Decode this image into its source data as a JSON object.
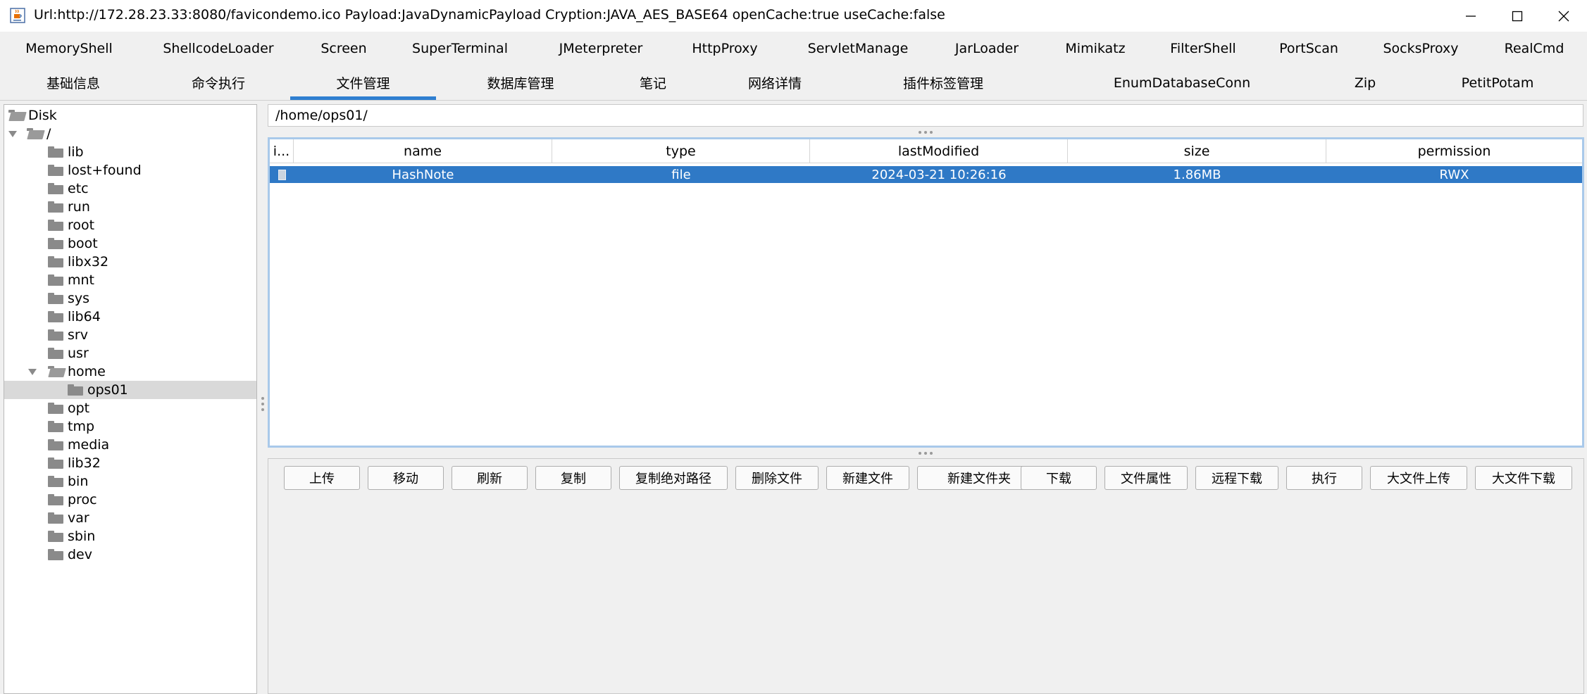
{
  "window": {
    "title": "Url:http://172.28.23.33:8080/favicondemo.ico Payload:JavaDynamicPayload Cryption:JAVA_AES_BASE64 openCache:true useCache:false"
  },
  "plugin_tabs": [
    "MemoryShell",
    "ShellcodeLoader",
    "Screen",
    "SuperTerminal",
    "JMeterpreter",
    "HttpProxy",
    "ServletManage",
    "JarLoader",
    "Mimikatz",
    "FilterShell",
    "PortScan",
    "SocksProxy",
    "RealCmd"
  ],
  "main_tabs": [
    "基础信息",
    "命令执行",
    "文件管理",
    "数据库管理",
    "笔记",
    "网络详情",
    "插件标签管理",
    "EnumDatabaseConn",
    "Zip",
    "PetitPotam"
  ],
  "active_main_tab": "文件管理",
  "tree": {
    "root_label": "Disk",
    "slash_label": "/",
    "items": [
      "lib",
      "lost+found",
      "etc",
      "run",
      "root",
      "boot",
      "libx32",
      "mnt",
      "sys",
      "lib64",
      "srv",
      "usr",
      "home",
      "ops01",
      "opt",
      "tmp",
      "media",
      "lib32",
      "bin",
      "proc",
      "var",
      "sbin",
      "dev"
    ],
    "selected": "ops01"
  },
  "path": "/home/ops01/",
  "table": {
    "headers": [
      "i...",
      "name",
      "type",
      "lastModified",
      "size",
      "permission"
    ],
    "rows": [
      {
        "name": "HashNote",
        "type": "file",
        "lastModified": "2024-03-21 10:26:16",
        "size": "1.86MB",
        "permission": "RWX"
      }
    ]
  },
  "buttons": [
    "上传",
    "移动",
    "刷新",
    "复制",
    "复制绝对路径",
    "删除文件",
    "新建文件",
    "新建文件夹",
    "下载",
    "文件属性",
    "远程下载",
    "执行",
    "大文件上传",
    "大文件下载"
  ],
  "colors": {
    "accent": "#2f7fd1",
    "selection": "#2f79c6"
  }
}
